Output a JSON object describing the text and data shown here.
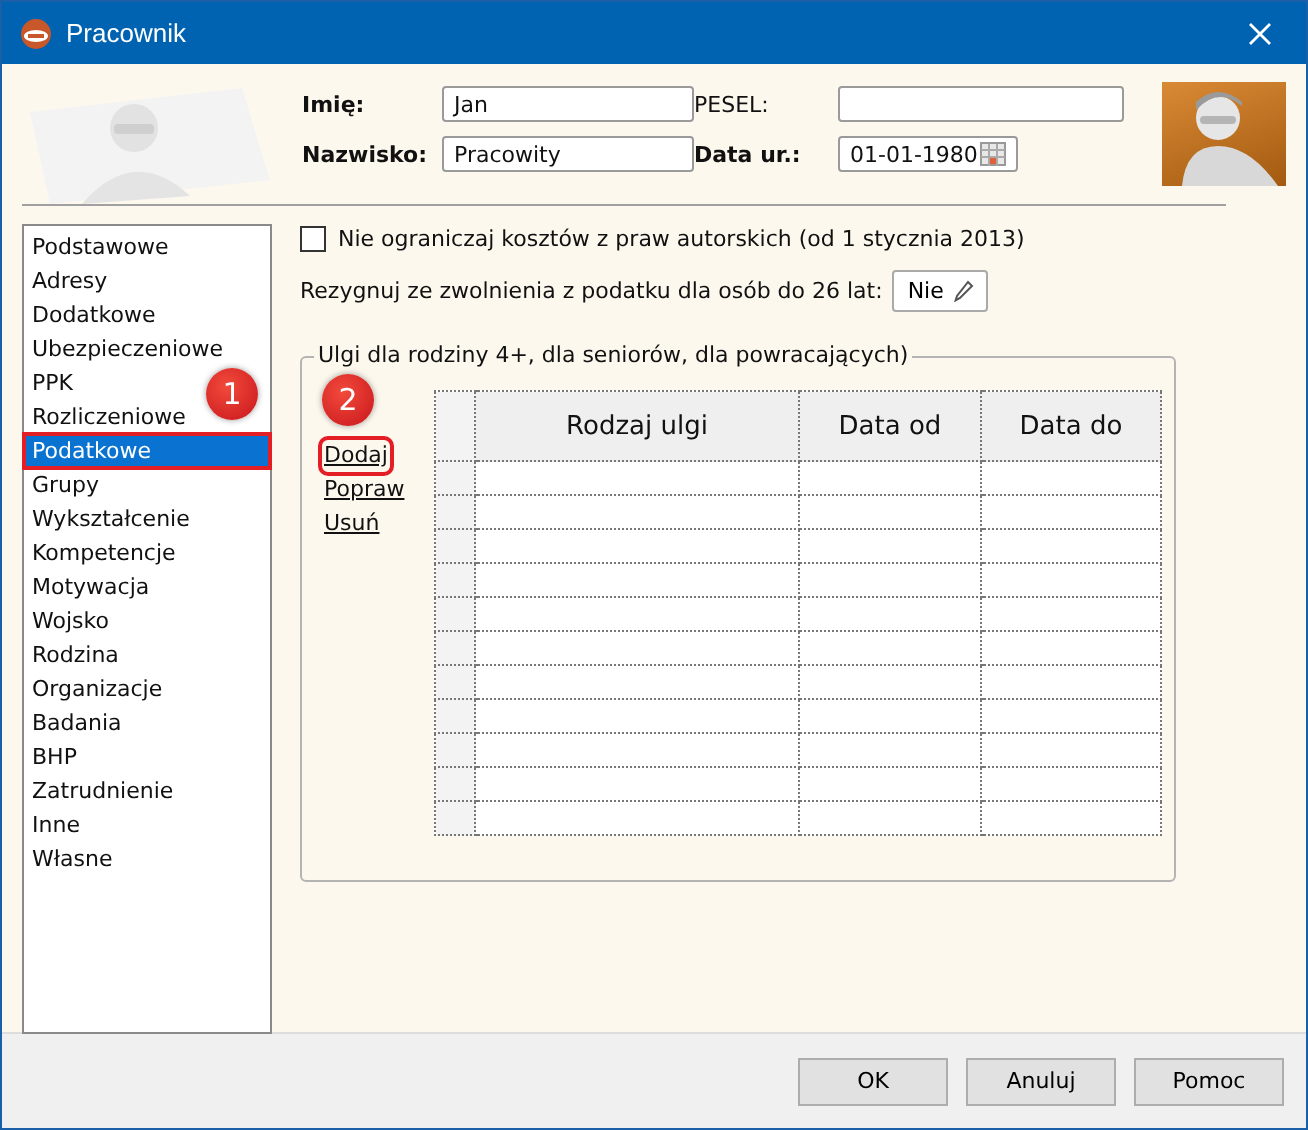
{
  "window": {
    "title": "Pracownik"
  },
  "person": {
    "first_name": {
      "label": "Imię:",
      "value": "Jan"
    },
    "last_name": {
      "label": "Nazwisko:",
      "value": "Pracowity"
    },
    "pesel": {
      "label": "PESEL:"
    },
    "birth_date": {
      "label": "Data ur.:",
      "value": "01-01-1980"
    }
  },
  "sidebar": {
    "items": [
      {
        "label": "Podstawowe",
        "selected": false,
        "highlighted": false
      },
      {
        "label": "Adresy",
        "selected": false,
        "highlighted": false
      },
      {
        "label": "Dodatkowe",
        "selected": false,
        "highlighted": false
      },
      {
        "label": "Ubezpieczeniowe",
        "selected": false,
        "highlighted": false
      },
      {
        "label": "PPK",
        "selected": false,
        "highlighted": false
      },
      {
        "label": "Rozliczeniowe",
        "selected": false,
        "highlighted": false
      },
      {
        "label": "Podatkowe",
        "selected": true,
        "highlighted": true
      },
      {
        "label": "Grupy",
        "selected": false,
        "highlighted": false
      },
      {
        "label": "Wykształcenie",
        "selected": false,
        "highlighted": false
      },
      {
        "label": "Kompetencje",
        "selected": false,
        "highlighted": false
      },
      {
        "label": "Motywacja",
        "selected": false,
        "highlighted": false
      },
      {
        "label": "Wojsko",
        "selected": false,
        "highlighted": false
      },
      {
        "label": "Rodzina",
        "selected": false,
        "highlighted": false
      },
      {
        "label": "Organizacje",
        "selected": false,
        "highlighted": false
      },
      {
        "label": "Badania",
        "selected": false,
        "highlighted": false
      },
      {
        "label": "BHP",
        "selected": false,
        "highlighted": false
      },
      {
        "label": "Zatrudnienie",
        "selected": false,
        "highlighted": false
      },
      {
        "label": "Inne",
        "selected": false,
        "highlighted": false
      },
      {
        "label": "Własne",
        "selected": false,
        "highlighted": false
      }
    ],
    "marker": "1"
  },
  "options": {
    "no_cost_limit": {
      "label": "Nie ograniczaj kosztów z praw autorskich (od 1 stycznia 2013)",
      "checked": false
    },
    "resign_exemption": {
      "label": "Rezygnuj ze zwolnienia z podatku dla osób do 26 lat:",
      "value": "Nie"
    }
  },
  "reliefs": {
    "title": "Ulgi dla rodziny 4+, dla seniorów, dla powracających)",
    "links": [
      {
        "label": "Dodaj",
        "highlighted": true
      },
      {
        "label": "Popraw",
        "highlighted": false
      },
      {
        "label": "Usuń",
        "highlighted": false
      }
    ],
    "table": {
      "columns": [
        "Rodzaj ulgi",
        "Data od",
        "Data do"
      ]
    },
    "marker": "2"
  },
  "buttons": [
    "OK",
    "Anuluj",
    "Pomoc"
  ]
}
